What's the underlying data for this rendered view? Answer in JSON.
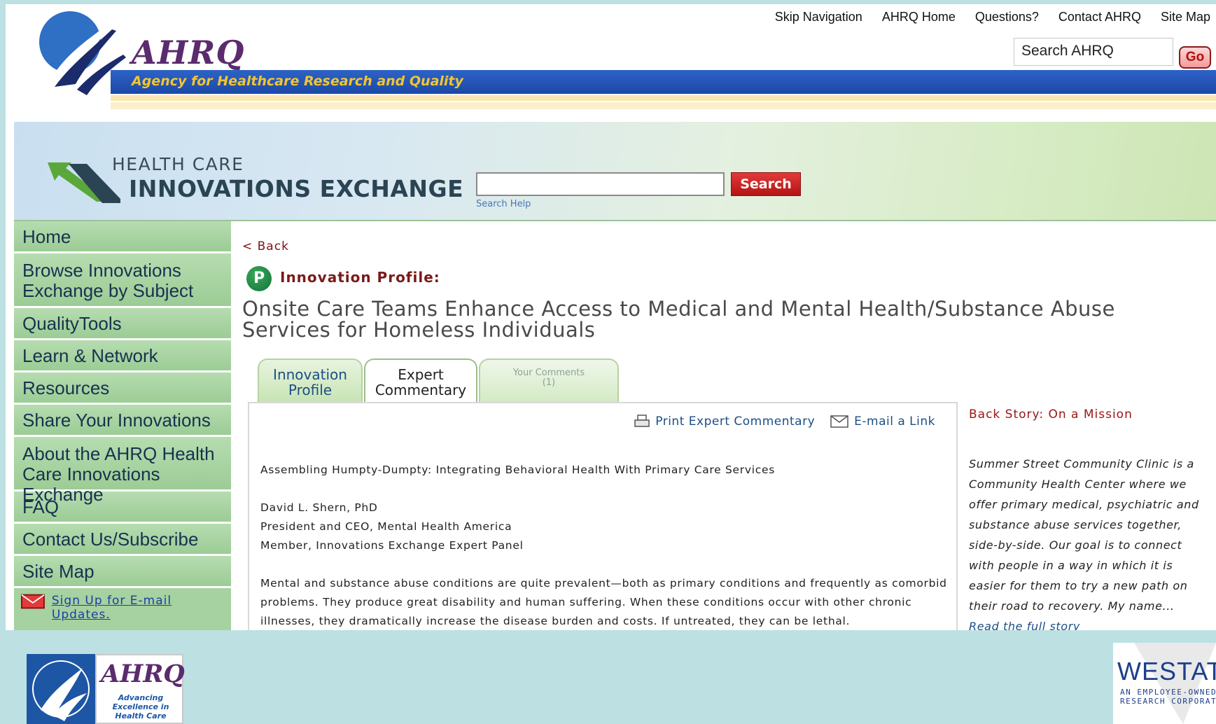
{
  "ahrq": {
    "logo_text": "AHRQ",
    "agency": "Agency for Healthcare Research and Quality",
    "nav": [
      "Skip Navigation",
      "AHRQ Home",
      "Questions?",
      "Contact AHRQ",
      "Site Map"
    ],
    "search_value": "Search AHRQ",
    "go_label": "Go"
  },
  "hcie": {
    "title_small": "HEALTH CARE",
    "title_big": "INNOVATIONS EXCHANGE",
    "search_label": "Search",
    "search_help": "Search Help"
  },
  "sidebar": {
    "items": [
      "Home",
      "Browse Innovations Exchange by Subject",
      "QualityTools",
      "Learn & Network",
      "Resources",
      "Share Your Innovations",
      "About the AHRQ Health Care Innovations Exchange",
      "FAQ",
      "Contact Us/Subscribe",
      "Site Map"
    ],
    "signup": "Sign Up for E-mail Updates."
  },
  "main": {
    "back": "< Back",
    "badge": "P",
    "profile_label": "Innovation Profile:",
    "title": "Onsite Care Teams Enhance Access to Medical and Mental Health/Substance Abuse Services for Homeless Individuals",
    "tabs": {
      "innovation_profile": "Innovation Profile",
      "expert_commentary": "Expert Commentary",
      "your_comments": "Your Comments",
      "comments_count": "(1)"
    },
    "actions": {
      "print": "Print Expert Commentary",
      "email": "E-mail a Link"
    },
    "article_title": "Assembling Humpty-Dumpty: Integrating Behavioral Health With Primary Care Services",
    "author": "David L. Shern, PhD",
    "author_role": "President and CEO, Mental Health America",
    "author_panel": "Member, Innovations Exchange Expert Panel",
    "body": "Mental and substance abuse conditions are quite prevalent—both as primary conditions and frequently as comorbid problems. They produce great disability and human suffering. When these conditions occur with other chronic illnesses, they dramatically increase the disease burden and costs. If untreated, they can be lethal."
  },
  "backstory": {
    "title": "Back Story: On a Mission",
    "text": "Summer Street Community Clinic is a Community Health Center where we offer primary medical, psychiatric and substance abuse services together, side-by-side. Our goal is to connect with people in a way in which it is easier for them to try a new path on their road to recovery. My name...",
    "link": "Read the full story"
  },
  "footer": {
    "ahrq_logo": "AHRQ",
    "ahrq_tagline": "Advancing Excellence in Health Care",
    "westat": "WESTAT",
    "westat_tag_1": "AN EMPLOYEE-OWNED",
    "westat_tag_2": "RESEARCH CORPORATION"
  },
  "colors": {
    "brand_blue": "#1c48a6",
    "agency_gold": "#f2c531",
    "sidebar_green": "#a6d1a0",
    "alert_red": "#b41414"
  }
}
